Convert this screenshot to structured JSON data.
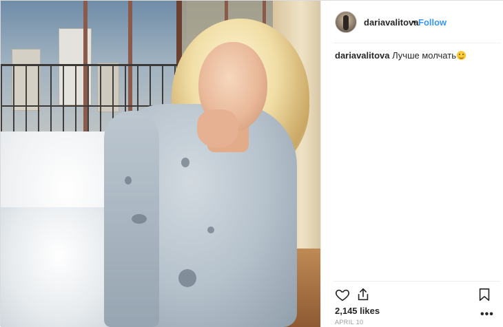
{
  "post": {
    "author": {
      "username": "dariavalitova",
      "separator": "•",
      "follow_label": "Follow"
    },
    "caption": {
      "username": "dariavalitova",
      "text": "Лучше молчать",
      "emoji": "smirking-face-emoji"
    },
    "likes_text": "2,145 likes",
    "date_text": "APRIL 10",
    "more_label": "•••"
  },
  "icons": {
    "like": "heart-icon",
    "share": "share-icon",
    "save": "bookmark-icon",
    "options": "more-options-icon"
  },
  "colors": {
    "follow_accent": "#3897f0",
    "text_primary": "#262626",
    "text_secondary": "#999999",
    "border": "#efefef"
  }
}
